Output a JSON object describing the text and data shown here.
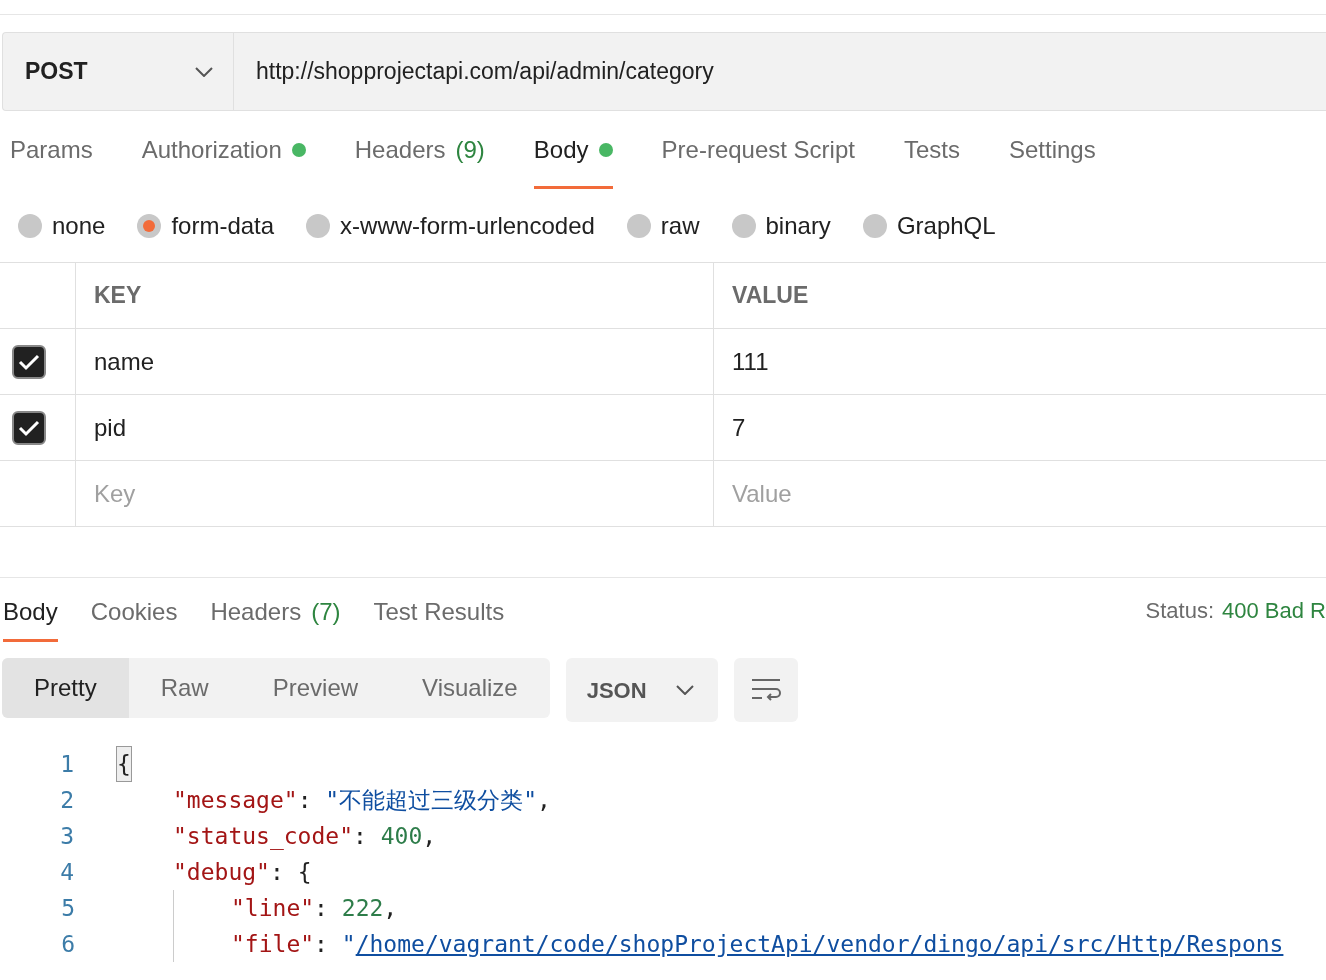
{
  "request": {
    "method": "POST",
    "url": "http://shopprojectapi.com/api/admin/category"
  },
  "request_tabs": [
    {
      "label": "Params",
      "selected": false
    },
    {
      "label": "Authorization",
      "selected": false,
      "color": "#49b764"
    },
    {
      "label": "Headers",
      "count": "(9)",
      "selected": false
    },
    {
      "label": "Body",
      "selected": true,
      "color": "#49b764"
    },
    {
      "label": "Pre-request Script",
      "selected": false
    },
    {
      "label": "Tests",
      "selected": false
    },
    {
      "label": "Settings",
      "selected": false
    }
  ],
  "body_types": [
    {
      "label": "none",
      "selected": false
    },
    {
      "label": "form-data",
      "selected": true
    },
    {
      "label": "x-www-form-urlencoded",
      "selected": false
    },
    {
      "label": "raw",
      "selected": false
    },
    {
      "label": "binary",
      "selected": false
    },
    {
      "label": "GraphQL",
      "selected": false
    }
  ],
  "params_table": {
    "columns": [
      "KEY",
      "VALUE"
    ],
    "rows": [
      {
        "key": "name",
        "value": "111",
        "checked": true
      },
      {
        "key": "pid",
        "value": "7",
        "checked": true
      }
    ],
    "new_row": {
      "key_placeholder": "Key",
      "value_placeholder": "Value"
    }
  },
  "response_tabs": [
    {
      "label": "Body",
      "selected": true
    },
    {
      "label": "Cookies",
      "selected": false
    },
    {
      "label": "Headers",
      "count": "(7)",
      "selected": false
    },
    {
      "label": "Test Results",
      "selected": false
    }
  ],
  "status": {
    "label": "Status:",
    "value": "400 Bad R"
  },
  "view_modes": [
    {
      "label": "Pretty",
      "selected": true
    },
    {
      "label": "Raw",
      "selected": false
    },
    {
      "label": "Preview",
      "selected": false
    },
    {
      "label": "Visualize",
      "selected": false
    }
  ],
  "format": "JSON",
  "code": [
    {
      "number": "1",
      "tokens": [
        {
          "kind": "brace",
          "text": "{"
        }
      ],
      "children": [
        {
          "number": "2",
          "tokens": [
            {
              "kind": "key",
              "text": "\"message\""
            },
            {
              "kind": "punct",
              "text": ": "
            },
            {
              "kind": "string",
              "text": "\"不能超过三级分类\""
            },
            {
              "kind": "punct",
              "text": ","
            }
          ]
        },
        {
          "number": "3",
          "tokens": [
            {
              "kind": "key",
              "text": "\"status_code\""
            },
            {
              "kind": "punct",
              "text": ": "
            },
            {
              "kind": "number",
              "text": "400"
            },
            {
              "kind": "punct",
              "text": ","
            }
          ]
        },
        {
          "number": "4",
          "tokens": [
            {
              "kind": "key",
              "text": "\"debug\""
            },
            {
              "kind": "punct",
              "text": ": {"
            }
          ],
          "children": [
            {
              "number": "5",
              "tokens": [
                {
                  "kind": "key",
                  "text": "\"line\""
                },
                {
                  "kind": "punct",
                  "text": ": "
                },
                {
                  "kind": "number",
                  "text": "222"
                },
                {
                  "kind": "punct",
                  "text": ","
                }
              ]
            },
            {
              "number": "6",
              "tokens": [
                {
                  "kind": "key",
                  "text": "\"file\""
                },
                {
                  "kind": "punct",
                  "text": ": "
                },
                {
                  "kind": "string",
                  "text": "\""
                },
                {
                  "kind": "link",
                  "text": "/home/vagrant/code/shopProjectApi/vendor/dingo/api/src/Http/Respons"
                }
              ]
            }
          ]
        }
      ]
    }
  ]
}
